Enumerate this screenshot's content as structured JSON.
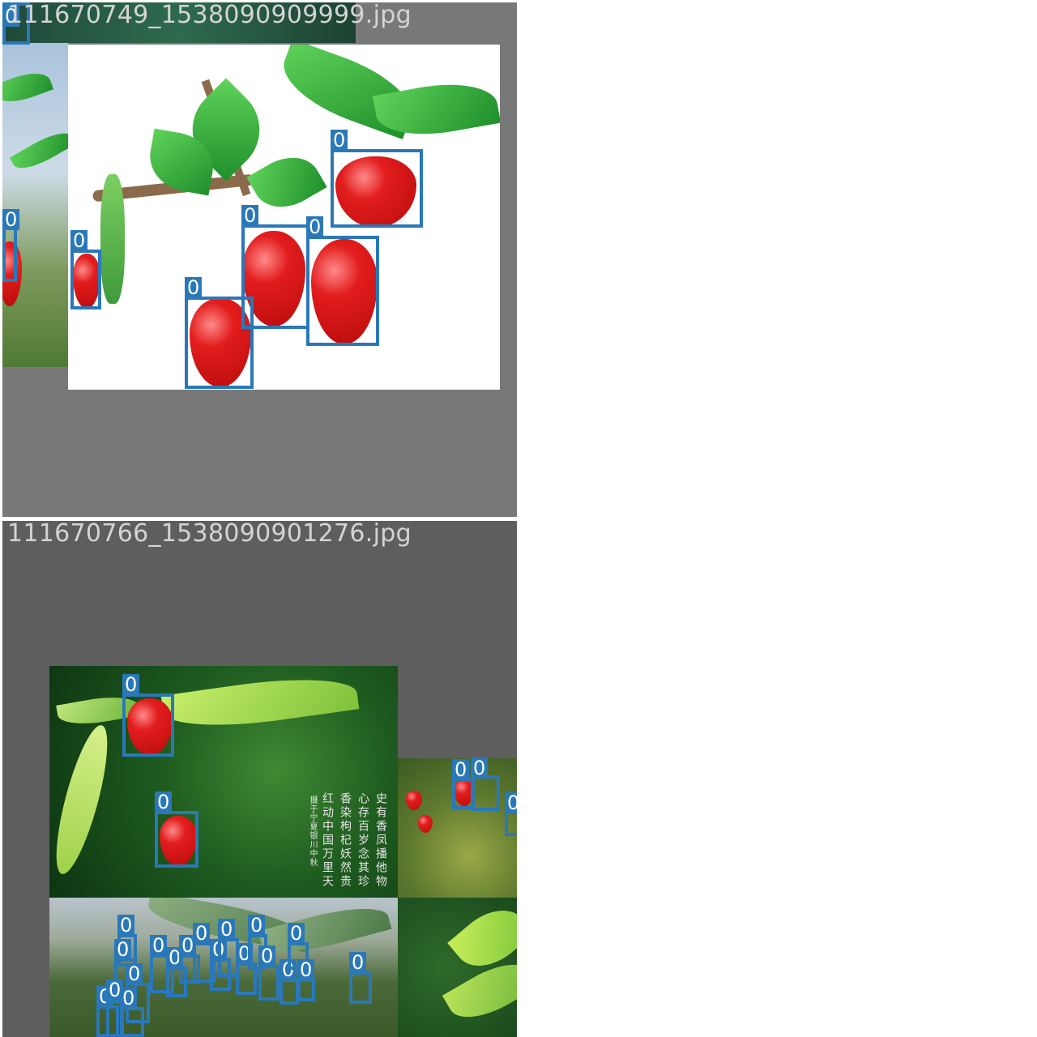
{
  "tiles": [
    {
      "filename": "111670749_1538090909999.jpg",
      "detections": [
        "0",
        "0",
        "0",
        "0",
        "0",
        "0",
        "0",
        "0"
      ]
    },
    {
      "filename": "111670766_1538090901276.jpg",
      "detections": [
        "0",
        "0",
        "0",
        "0",
        "0",
        "0",
        "0",
        "0",
        "0",
        "0",
        "0",
        "0",
        "0",
        "0",
        "0",
        "0",
        "0",
        "0",
        "0",
        "0",
        "0",
        "0",
        "0",
        "0"
      ]
    }
  ],
  "poem": {
    "lines": [
      "史有香凤播他物",
      "心存百岁念其珍",
      "香染枸杞妖然贵",
      "红动中国万里天"
    ],
    "signature": "摄于宁夏银川中秋"
  },
  "colors": {
    "box": "#2a78b8",
    "label_text": "#ffffff",
    "tile_bg_top": "#787878",
    "tile_bg_bottom": "#5e5e5e"
  }
}
